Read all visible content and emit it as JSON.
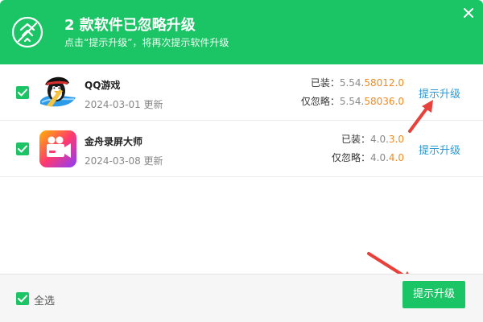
{
  "header": {
    "title": "2 款软件已忽略升级",
    "subtitle": "点击“提示升级”，将再次提示软件升级",
    "icon": "ignore-upgrade-icon",
    "close_icon": "close-icon"
  },
  "apps": [
    {
      "name": "QQ游戏",
      "date": "2024-03-01 更新",
      "icon": "qq-game-penguin-icon",
      "checked": true,
      "installed_label": "已装：",
      "installed_base": "5.54.",
      "installed_hl": "58012.0",
      "ignored_label": "仅忽略：",
      "ignored_base": "5.54.",
      "ignored_hl": "58036.0",
      "action": "提示升级"
    },
    {
      "name": "金舟录屏大师",
      "date": "2024-03-08 更新",
      "icon": "screen-recorder-camera-icon",
      "checked": true,
      "installed_label": "已装：",
      "installed_base": "4.0.",
      "installed_hl": "3.0",
      "ignored_label": "仅忽略：",
      "ignored_base": "4.0.",
      "ignored_hl": "4.0",
      "action": "提示升级"
    }
  ],
  "footer": {
    "select_all": "全选",
    "upgrade_button": "提示升级"
  },
  "colors": {
    "brand_green": "#1bc565",
    "link_blue": "#2a9ad8",
    "version_orange": "#f08a24",
    "arrow_red": "#e8403a"
  }
}
